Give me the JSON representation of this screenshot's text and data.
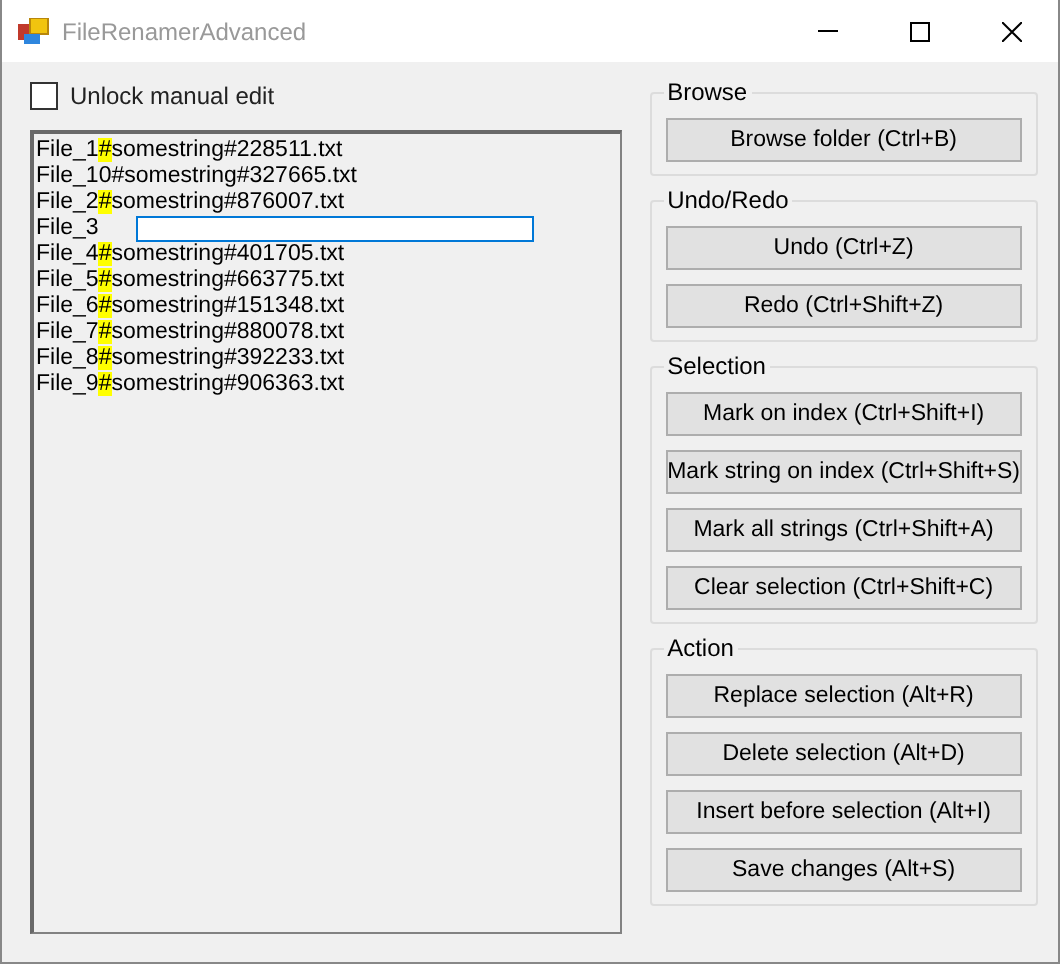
{
  "window": {
    "title": "FileRenamerAdvanced"
  },
  "unlock_manual_edit": {
    "label": "Unlock manual edit",
    "checked": false
  },
  "files": [
    {
      "kind": "file",
      "name": "File_1",
      "separator": "#",
      "marked": true,
      "rest": "somestring#228511.txt"
    },
    {
      "kind": "file",
      "name": "File_10",
      "separator": "#",
      "marked": false,
      "rest": "somestring#327665.txt"
    },
    {
      "kind": "file",
      "name": "File_2",
      "separator": "#",
      "marked": true,
      "rest": "somestring#876007.txt"
    },
    {
      "kind": "editing",
      "name": "File_3"
    },
    {
      "kind": "file",
      "name": "File_4",
      "separator": "#",
      "marked": true,
      "rest": "somestring#401705.txt"
    },
    {
      "kind": "file",
      "name": "File_5",
      "separator": "#",
      "marked": true,
      "rest": "somestring#663775.txt"
    },
    {
      "kind": "file",
      "name": "File_6",
      "separator": "#",
      "marked": true,
      "rest": "somestring#151348.txt"
    },
    {
      "kind": "file",
      "name": "File_7",
      "separator": "#",
      "marked": true,
      "rest": "somestring#880078.txt"
    },
    {
      "kind": "file",
      "name": "File_8",
      "separator": "#",
      "marked": true,
      "rest": "somestring#392233.txt"
    },
    {
      "kind": "file",
      "name": "File_9",
      "separator": "#",
      "marked": true,
      "rest": "somestring#906363.txt"
    }
  ],
  "groups": [
    {
      "title": "Browse",
      "buttons": [
        "Browse folder (Ctrl+B)"
      ]
    },
    {
      "title": "Undo/Redo",
      "buttons": [
        "Undo (Ctrl+Z)",
        "Redo (Ctrl+Shift+Z)"
      ]
    },
    {
      "title": "Selection",
      "buttons": [
        "Mark on index (Ctrl+Shift+I)",
        "Mark string on index (Ctrl+Shift+S)",
        "Mark all strings (Ctrl+Shift+A)",
        "Clear selection (Ctrl+Shift+C)"
      ]
    },
    {
      "title": "Action",
      "buttons": [
        "Replace selection (Alt+R)",
        "Delete selection (Alt+D)",
        "Insert before selection (Alt+I)",
        "Save changes (Alt+S)"
      ]
    }
  ]
}
